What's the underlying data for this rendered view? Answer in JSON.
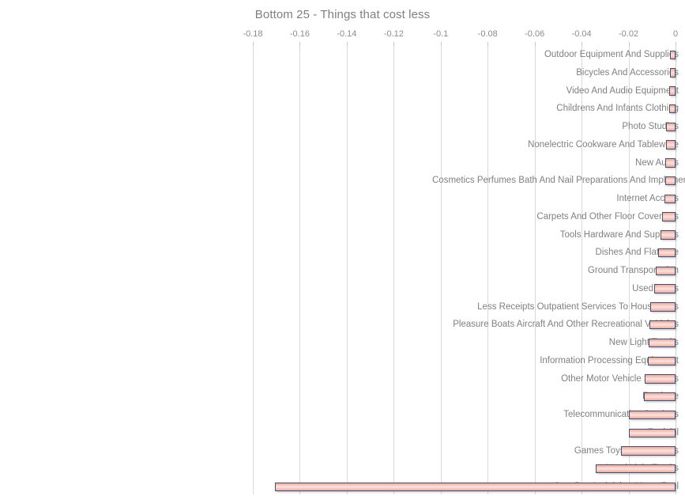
{
  "chart_data": {
    "type": "bar",
    "orientation": "horizontal",
    "title": "Bottom 25 - Things that cost less",
    "xlabel": "",
    "ylabel": "",
    "xlim": [
      -0.18,
      0
    ],
    "grid": true,
    "legend": false,
    "x_ticks": [
      -0.18,
      -0.16,
      -0.14,
      -0.12,
      -0.1,
      -0.08,
      -0.06,
      -0.04,
      -0.02,
      0
    ],
    "x_tick_labels": [
      "-0.18",
      "-0.16",
      "-0.14",
      "-0.12",
      "-0.1",
      "-0.08",
      "-0.06",
      "-0.04",
      "-0.02",
      "0"
    ],
    "categories": [
      "Outdoor Equipment And Supplies",
      "Bicycles And Accessories",
      "Video And Audio Equipment",
      "Childrens And Infants Clothing",
      "Photo Studios",
      "Nonelectric Cookware And Tableware",
      "New Autos",
      "Cosmetics Perfumes Bath And Nail Preparations And Implements",
      "Internet Access",
      "Carpets And Other Floor Coverings",
      "Tools Hardware And Supplies",
      "Dishes And Flatware",
      "Ground Transportation",
      "Used Autos",
      "Less Receipts Outpatient Services To Households",
      "Pleasure Boats Aircraft And Other Recreational Vehicles",
      "New Light Trucks",
      "Information Processing Equipment",
      "Other Motor Vehicle Services",
      "Furniture",
      "Telecommunication Services",
      "Fuel Oil",
      "Games Toys And Hobbies",
      "Used Light Trucks",
      "Gasoline And Other Motor Fuel"
    ],
    "values": [
      -0.0024,
      -0.0025,
      -0.0027,
      -0.0028,
      -0.004,
      -0.0041,
      -0.0044,
      -0.0044,
      -0.0047,
      -0.0057,
      -0.0064,
      -0.0074,
      -0.0084,
      -0.0091,
      -0.0108,
      -0.0111,
      -0.0114,
      -0.0118,
      -0.0131,
      -0.0134,
      -0.0198,
      -0.0199,
      -0.0232,
      -0.034,
      -0.1706
    ]
  },
  "style": {
    "title_color": "#7f7f7f",
    "label_color": "#808080",
    "tick_color": "#8c8c8c",
    "gridline_color": "#d9d9d9",
    "bar_border_color": "#4a5068",
    "bar_fill_light": "#fbe2de",
    "bar_fill_dark": "#e9a9a0",
    "background": "#ffffff"
  }
}
